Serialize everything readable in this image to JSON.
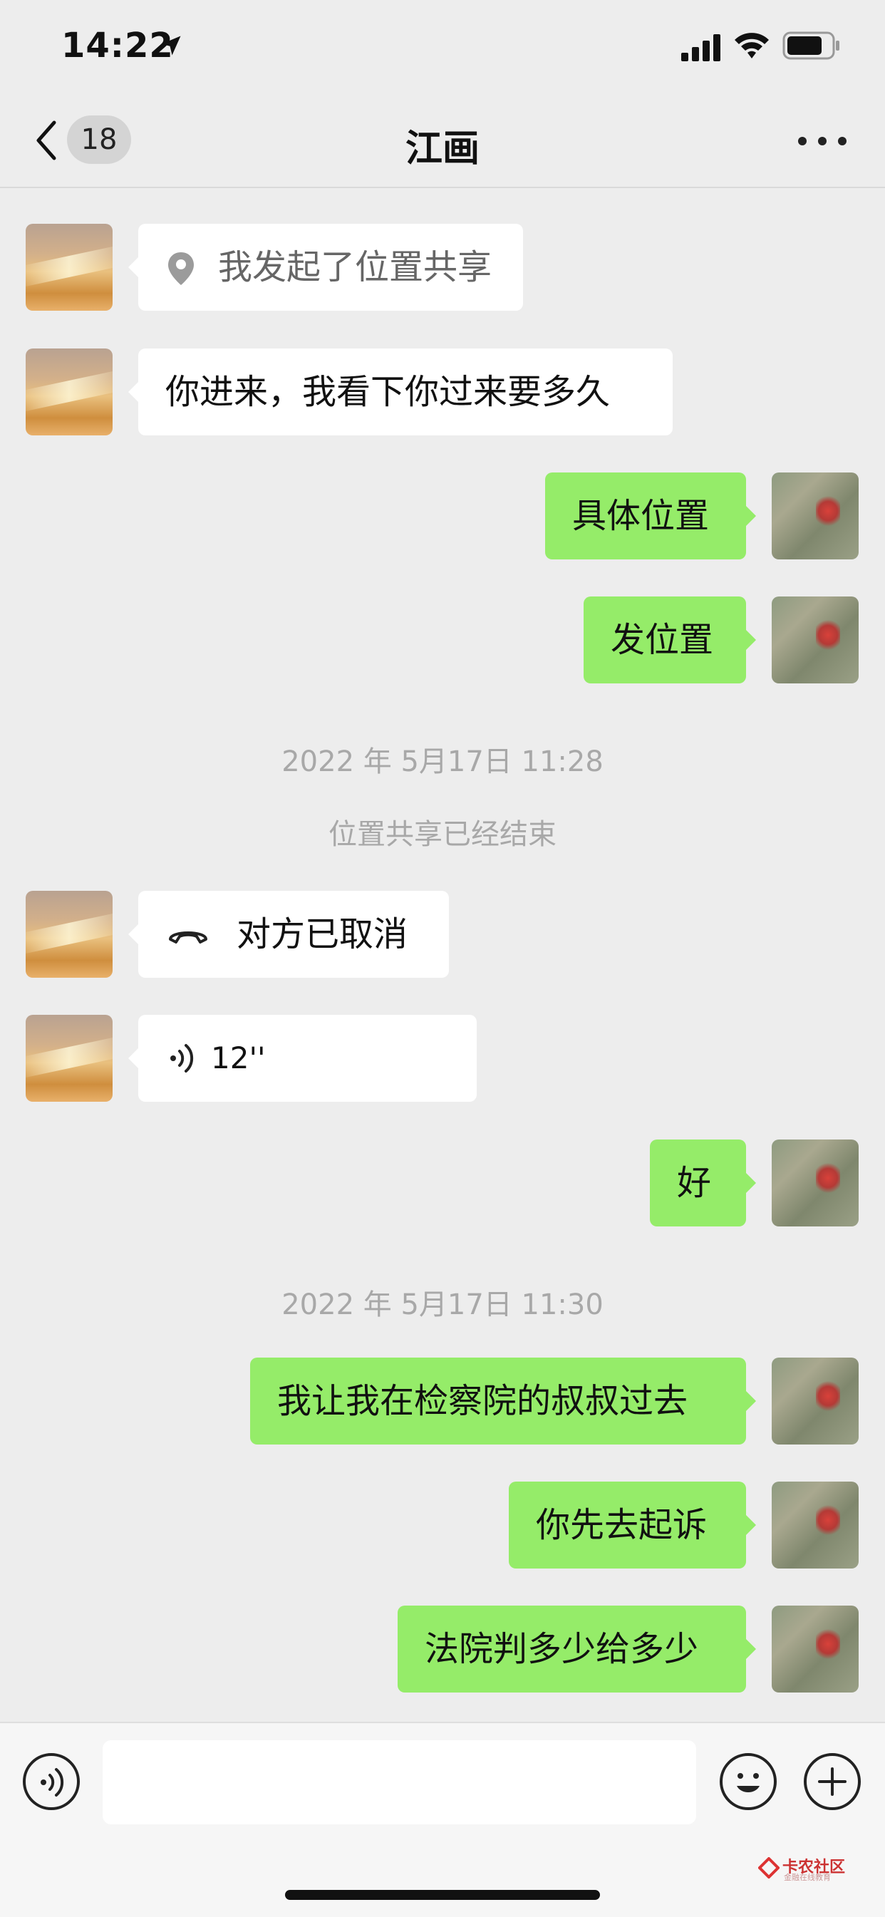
{
  "status_bar": {
    "time": "14:22"
  },
  "nav": {
    "unread_count": "18",
    "title": "江画"
  },
  "messages": [
    {
      "side": "left",
      "kind": "location",
      "text": "我发起了位置共享"
    },
    {
      "side": "left",
      "kind": "text",
      "text": "你进来，我看下你过来要多久"
    },
    {
      "side": "right",
      "kind": "text",
      "text": "具体位置"
    },
    {
      "side": "right",
      "kind": "text",
      "text": "发位置"
    },
    {
      "kind": "timestamp",
      "text": "2022 年 5月17日 11:28"
    },
    {
      "kind": "system",
      "text": "位置共享已经结束"
    },
    {
      "side": "left",
      "kind": "call",
      "text": "对方已取消"
    },
    {
      "side": "left",
      "kind": "voice",
      "text": "12''"
    },
    {
      "side": "right",
      "kind": "text",
      "text": "好"
    },
    {
      "kind": "timestamp",
      "text": "2022 年 5月17日 11:30"
    },
    {
      "side": "right",
      "kind": "text",
      "text": "我让我在检察院的叔叔过去"
    },
    {
      "side": "right",
      "kind": "text",
      "text": "你先去起诉"
    },
    {
      "side": "right",
      "kind": "text",
      "text": "法院判多少给多少"
    }
  ],
  "input_bar": {
    "value": ""
  },
  "watermark": {
    "title": "卡农社区",
    "subtitle": "金融在线教育"
  },
  "colors": {
    "sent_bubble": "#95ec69",
    "received_bubble": "#ffffff",
    "background": "#ededed"
  }
}
